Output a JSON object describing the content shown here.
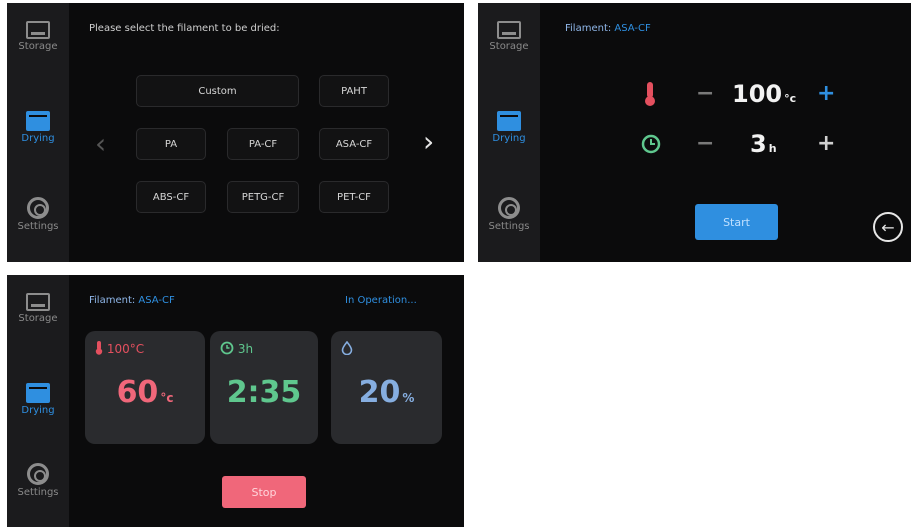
{
  "sidebar": {
    "items": [
      {
        "label": "Storage",
        "icon": "storage-icon"
      },
      {
        "label": "Drying",
        "icon": "drying-icon"
      },
      {
        "label": "Settings",
        "icon": "gear-icon"
      }
    ]
  },
  "screen1": {
    "prompt": "Please select the filament to be dried:",
    "filaments": [
      "Custom",
      "PAHT",
      "PA",
      "PA-CF",
      "ASA-CF",
      "ABS-CF",
      "PETG-CF",
      "PET-CF"
    ],
    "prev_arrow": "‹",
    "next_arrow": "›"
  },
  "screen2": {
    "filament_label": "Filament:",
    "filament_value": "ASA-CF",
    "temp_value": "100",
    "temp_unit": "°c",
    "time_value": "3",
    "time_unit": "h",
    "minus": "−",
    "plus": "+",
    "start_label": "Start",
    "back_icon": "←"
  },
  "screen3": {
    "filament_label": "Filament:",
    "filament_value": "ASA-CF",
    "status": "In Operation...",
    "temp_target": "100°C",
    "temp_current": "60",
    "temp_unit": "°c",
    "time_target": "3h",
    "time_remaining": "2:35",
    "humidity": "20",
    "humidity_unit": "%",
    "stop_label": "Stop"
  },
  "colors": {
    "accent": "#2f8fe0",
    "temp": "#f0677a",
    "time": "#5fc78e",
    "humidity": "#86aee0",
    "background": "#0b0b0c"
  }
}
